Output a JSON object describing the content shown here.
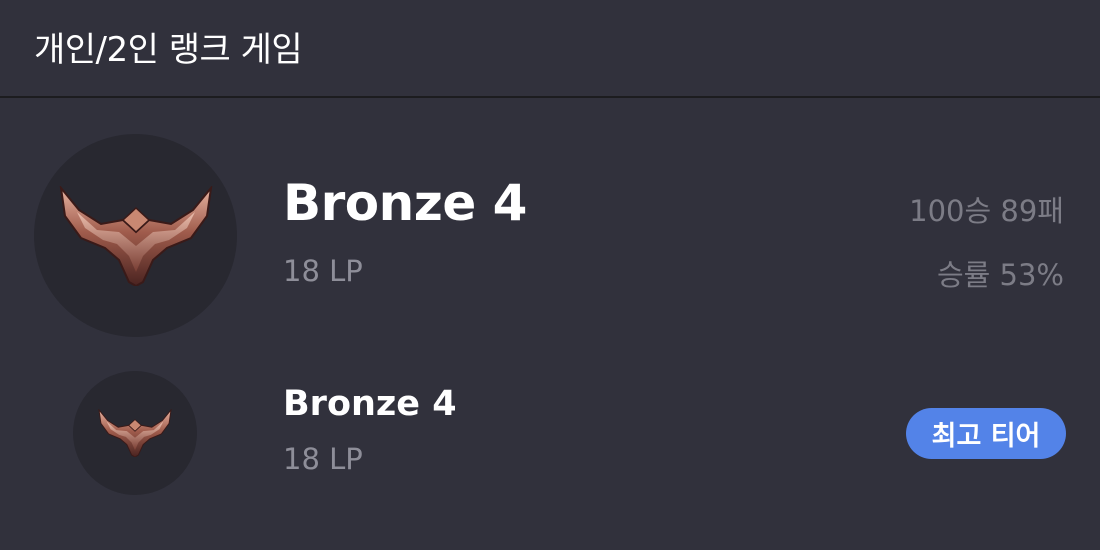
{
  "header": {
    "title": "개인/2인 랭크 게임"
  },
  "current": {
    "emblem_icon": "bronze-emblem-icon",
    "tier": "Bronze 4",
    "lp": "18 LP",
    "record": "100승 89패",
    "winrate": "승률 53%"
  },
  "best": {
    "emblem_icon": "bronze-emblem-icon",
    "tier": "Bronze 4",
    "lp": "18 LP",
    "badge": "최고 티어"
  },
  "colors": {
    "background": "#31313c",
    "emblem_bg": "#282830",
    "accent": "#5383e8",
    "bronze": "#9a5a4a"
  }
}
